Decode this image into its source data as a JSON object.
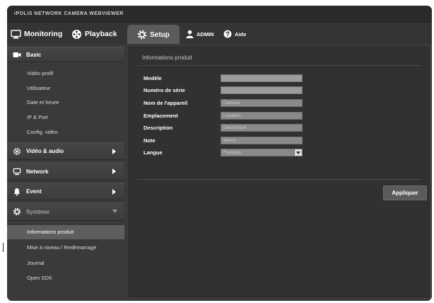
{
  "app": {
    "title": "iPOLiS NETWORK CAMERA WEBVIEWER"
  },
  "nav": {
    "monitoring": {
      "label": "Monitoring",
      "icon": "monitor-icon"
    },
    "playback": {
      "label": "Playback",
      "icon": "playback-icon"
    },
    "setup": {
      "label": "Setup",
      "icon": "gear-icon",
      "active": true
    },
    "user": {
      "label": "ADMIN",
      "icon": "user-icon"
    },
    "help": {
      "label": "Aide",
      "icon": "help-icon"
    }
  },
  "sidebar": {
    "basic": {
      "label": "Basic",
      "icon": "camera-icon",
      "expanded": true,
      "items": [
        "Vidéo profil",
        "Utilisateur",
        "Date et heure",
        "IP & Port",
        "Config. vidéo"
      ]
    },
    "sections": [
      {
        "label": "Vidéo & audio",
        "icon": "video-audio-icon",
        "expanded": false
      },
      {
        "label": "Network",
        "icon": "network-icon",
        "expanded": false
      },
      {
        "label": "Event",
        "icon": "event-icon",
        "expanded": false
      },
      {
        "label": "Système",
        "icon": "system-icon",
        "expanded": true
      }
    ],
    "system_items": [
      {
        "label": "Informations produit",
        "selected": true
      },
      {
        "label": "Mise à niveau / Redémarrage",
        "selected": false
      },
      {
        "label": "Journal",
        "selected": false
      },
      {
        "label": "Open SDK",
        "selected": false
      }
    ]
  },
  "main": {
    "title": "Informations produit",
    "fields": [
      {
        "label": "Modèle",
        "value": ""
      },
      {
        "label": "Numéro de série",
        "value": ""
      },
      {
        "label": "Nom de l'appareil",
        "value": "Camera"
      },
      {
        "label": "Emplacement",
        "value": "Location"
      },
      {
        "label": "Description",
        "value": "Description"
      },
      {
        "label": "Note",
        "value": "Memo"
      }
    ],
    "language": {
      "label": "Langue",
      "value": "Français"
    },
    "apply_label": "Appliquer"
  },
  "colors": {
    "frame": "#3a3a3a",
    "titlebar": "#2b2b2b",
    "navbar": "#343434",
    "active_tab": "#5b5b5b",
    "sidebar": "#3a3a3a",
    "selected_item": "#5e5e5e",
    "panel": "#313131",
    "field": "#8a8a8a",
    "field_readonly": "#9c9c9c",
    "button": "#5b5b5b"
  }
}
